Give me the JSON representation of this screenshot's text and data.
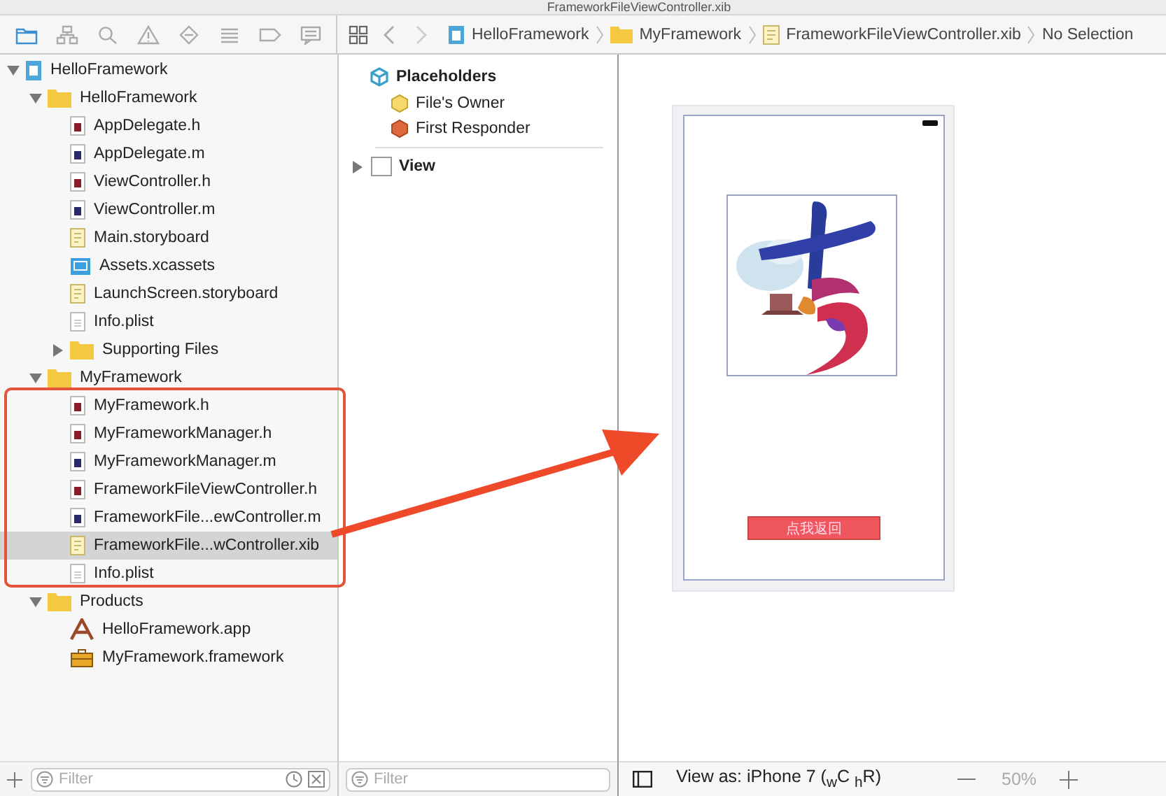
{
  "window": {
    "title": "FrameworkFileViewController.xib"
  },
  "navigator_tabs": [
    {
      "kind": "folder",
      "selected": true
    },
    {
      "kind": "hierarchy",
      "selected": false
    },
    {
      "kind": "search",
      "selected": false
    },
    {
      "kind": "warning",
      "selected": false
    },
    {
      "kind": "test",
      "selected": false
    },
    {
      "kind": "list",
      "selected": false
    },
    {
      "kind": "tag",
      "selected": false
    },
    {
      "kind": "report",
      "selected": false
    }
  ],
  "jump_bar": [
    {
      "kind": "project",
      "label": "HelloFramework"
    },
    {
      "kind": "folder",
      "label": "MyFramework"
    },
    {
      "kind": "xib",
      "label": "FrameworkFileViewController.xib"
    },
    {
      "kind": "none",
      "label": "No Selection"
    }
  ],
  "navigator": {
    "tree": [
      {
        "kind": "project",
        "label": "HelloFramework",
        "expanded": true,
        "selected": false,
        "children": [
          {
            "kind": "folder",
            "label": "HelloFramework",
            "expanded": true,
            "selected": false,
            "children": [
              {
                "kind": "h",
                "label": "AppDelegate.h",
                "selected": false
              },
              {
                "kind": "m",
                "label": "AppDelegate.m",
                "selected": false
              },
              {
                "kind": "h",
                "label": "ViewController.h",
                "selected": false
              },
              {
                "kind": "m",
                "label": "ViewController.m",
                "selected": false
              },
              {
                "kind": "storyboard",
                "label": "Main.storyboard",
                "selected": false
              },
              {
                "kind": "assets",
                "label": "Assets.xcassets",
                "selected": false
              },
              {
                "kind": "storyboard",
                "label": "LaunchScreen.storyboard",
                "selected": false
              },
              {
                "kind": "plist",
                "label": "Info.plist",
                "selected": false
              },
              {
                "kind": "folder",
                "label": "Supporting Files",
                "expanded": false,
                "selected": false
              }
            ]
          },
          {
            "kind": "folder",
            "label": "MyFramework",
            "expanded": true,
            "selected": false,
            "children": [
              {
                "kind": "h",
                "label": "MyFramework.h",
                "selected": false
              },
              {
                "kind": "h",
                "label": "MyFrameworkManager.h",
                "selected": false
              },
              {
                "kind": "m",
                "label": "MyFrameworkManager.m",
                "selected": false
              },
              {
                "kind": "h",
                "label": "FrameworkFileViewController.h",
                "selected": false
              },
              {
                "kind": "m",
                "label": "FrameworkFile...ewController.m",
                "selected": false
              },
              {
                "kind": "xib",
                "label": "FrameworkFile...wController.xib",
                "selected": true
              },
              {
                "kind": "plist",
                "label": "Info.plist",
                "selected": false
              }
            ]
          },
          {
            "kind": "folder",
            "label": "Products",
            "expanded": true,
            "selected": false,
            "children": [
              {
                "kind": "app",
                "label": "HelloFramework.app",
                "selected": false
              },
              {
                "kind": "framework",
                "label": "MyFramework.framework",
                "selected": false
              }
            ]
          }
        ]
      }
    ],
    "filter": {
      "placeholder": "Filter"
    }
  },
  "outline": {
    "section": "Placeholders",
    "items": [
      {
        "kind": "owner",
        "label": "File's Owner"
      },
      {
        "kind": "responder",
        "label": "First Responder"
      }
    ],
    "view": {
      "label": "View",
      "expanded": false
    },
    "filter": {
      "placeholder": "Filter"
    }
  },
  "canvas": {
    "button": "点我返回",
    "view_as": "View as: iPhone 7 ($_{w}$C $_{h}$R)",
    "zoom": "50%"
  }
}
